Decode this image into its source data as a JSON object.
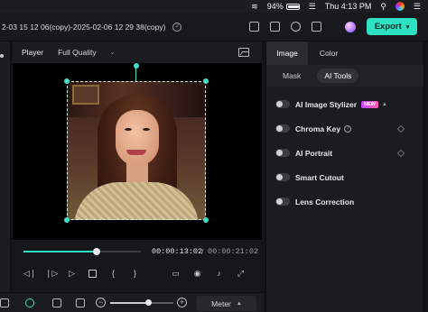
{
  "menubar": {
    "battery": "94%",
    "battery_level": 0.94,
    "clock": "Thu 4:13 PM"
  },
  "toolbar": {
    "project_title": "2-03 15 12 06(copy)-2025-02-06 12 29 38(copy)",
    "export_label": "Export",
    "accent": "#2fe1c3"
  },
  "player": {
    "label": "Player",
    "quality": "Full Quality",
    "timecode_current": "00:00:13:02",
    "timecode_separator": "/",
    "timecode_total": "00:00:21:02",
    "progress": 0.62,
    "controls": [
      "prev-frame-icon",
      "next-frame-icon",
      "play-icon",
      "stop-icon",
      "mark-in-icon",
      "mark-out-icon",
      "display-icon",
      "snapshot-icon",
      "audio-icon",
      "fullscreen-icon"
    ]
  },
  "timeline": {
    "zoom_level": 0.6,
    "meter_label": "Meter"
  },
  "panel": {
    "tabs": [
      "Image",
      "Color"
    ],
    "active_tab": "Image",
    "subtabs": [
      "Mask",
      "AI Tools"
    ],
    "active_subtab": "AI Tools",
    "new_badge": "NEW",
    "tools": [
      {
        "label": "AI Image Stylizer",
        "enabled": false
      },
      {
        "label": "Chroma Key",
        "enabled": false
      },
      {
        "label": "AI Portrait",
        "enabled": false
      },
      {
        "label": "Smart Cutout",
        "enabled": false
      },
      {
        "label": "Lens Correction",
        "enabled": false
      }
    ]
  }
}
